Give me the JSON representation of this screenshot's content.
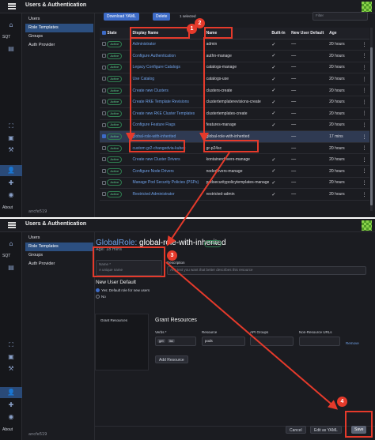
{
  "app": {
    "title": "Users & Authentication",
    "version": "ancfe519",
    "nav": {
      "items": [
        {
          "label": "Users"
        },
        {
          "label": "Role Templates"
        },
        {
          "label": "Groups"
        },
        {
          "label": "Auth Provider"
        }
      ]
    },
    "rail": {
      "sqt": "SQT",
      "about": "About"
    }
  },
  "list_view": {
    "toolbar": {
      "download": "Download YAML",
      "delete": "Delete",
      "selected": "1 selected",
      "filter_placeholder": "Filter"
    },
    "columns": [
      "State",
      "Display Name",
      "Name",
      "Built-In",
      "New User Default",
      "Age"
    ],
    "rows": [
      {
        "state": "Active",
        "display": "Administrator",
        "name": "admin",
        "builtin": "✓",
        "age": "20 hours"
      },
      {
        "state": "Active",
        "display": "Configure Authentication",
        "name": "authn-manage",
        "builtin": "✓",
        "age": "20 hours"
      },
      {
        "state": "Active",
        "display": "Legacy Configure Catalogs",
        "name": "catalogs-manage",
        "builtin": "✓",
        "age": "20 hours"
      },
      {
        "state": "Active",
        "display": "Use Catalog",
        "name": "catalogs-use",
        "builtin": "✓",
        "age": "20 hours"
      },
      {
        "state": "Active",
        "display": "Create new Clusters",
        "name": "clusters-create",
        "builtin": "✓",
        "age": "20 hours"
      },
      {
        "state": "Active",
        "display": "Create RKE Template Revisions",
        "name": "clustertemplaterevisions-create",
        "builtin": "✓",
        "age": "20 hours"
      },
      {
        "state": "Active",
        "display": "Create new RKE Cluster Templates",
        "name": "clustertemplates-create",
        "builtin": "✓",
        "age": "20 hours"
      },
      {
        "state": "Active",
        "display": "Configure Feature Flags",
        "name": "features-manage",
        "builtin": "✓",
        "age": "20 hours"
      },
      {
        "state": "Active",
        "display": "global-role-with-inherited",
        "name": "global-role-with-inherited",
        "builtin": "",
        "age": "17 mins",
        "selected": true
      },
      {
        "state": "Active",
        "display": "custom gr2-changedvia-kubec",
        "name": "gr-p24sc",
        "builtin": "",
        "age": "20 hours"
      },
      {
        "state": "Active",
        "display": "Create new Cluster Drivers",
        "name": "kontainerdrivers-manage",
        "builtin": "✓",
        "age": "20 hours"
      },
      {
        "state": "Active",
        "display": "Configure Node Drivers",
        "name": "nodedrivers-manage",
        "builtin": "✓",
        "age": "20 hours"
      },
      {
        "state": "Active",
        "display": "Manage Pod Security Policies (PSPs)",
        "name": "podsecuritypolicytemplates-manage",
        "builtin": "✓",
        "age": "20 hours"
      },
      {
        "state": "Active",
        "display": "Restricted Administrator",
        "name": "restricted-admin",
        "builtin": "✓",
        "age": "20 hours"
      }
    ]
  },
  "edit_view": {
    "kind": "GlobalRole:",
    "name": "global-role-with-inherited",
    "status": "Active",
    "age": "Age: 18 mins",
    "name_label": "Name *",
    "name_placeholder": "A unique name",
    "desc_label": "Description",
    "desc_placeholder": "Any text you want that better describes this resource",
    "new_user_default_title": "New User Default",
    "radio_yes": "Yes: Default role for new users",
    "radio_no": "No",
    "tab_grant": "Grant Resources",
    "grant_title": "Grant Resources",
    "verbs_label": "Verbs *",
    "verbs": [
      "get",
      "list"
    ],
    "resource_label": "Resource",
    "resource_value": "pods",
    "api_groups_label": "API Groups",
    "non_resource_label": "Non-Resource URLs",
    "remove": "Remove",
    "add_resource": "Add Resource",
    "cancel": "Cancel",
    "edit_yaml": "Edit as YAML",
    "save": "Save"
  },
  "annotations": {
    "markers": [
      "1",
      "2",
      "3",
      "4"
    ],
    "color": "#e53a2b"
  }
}
